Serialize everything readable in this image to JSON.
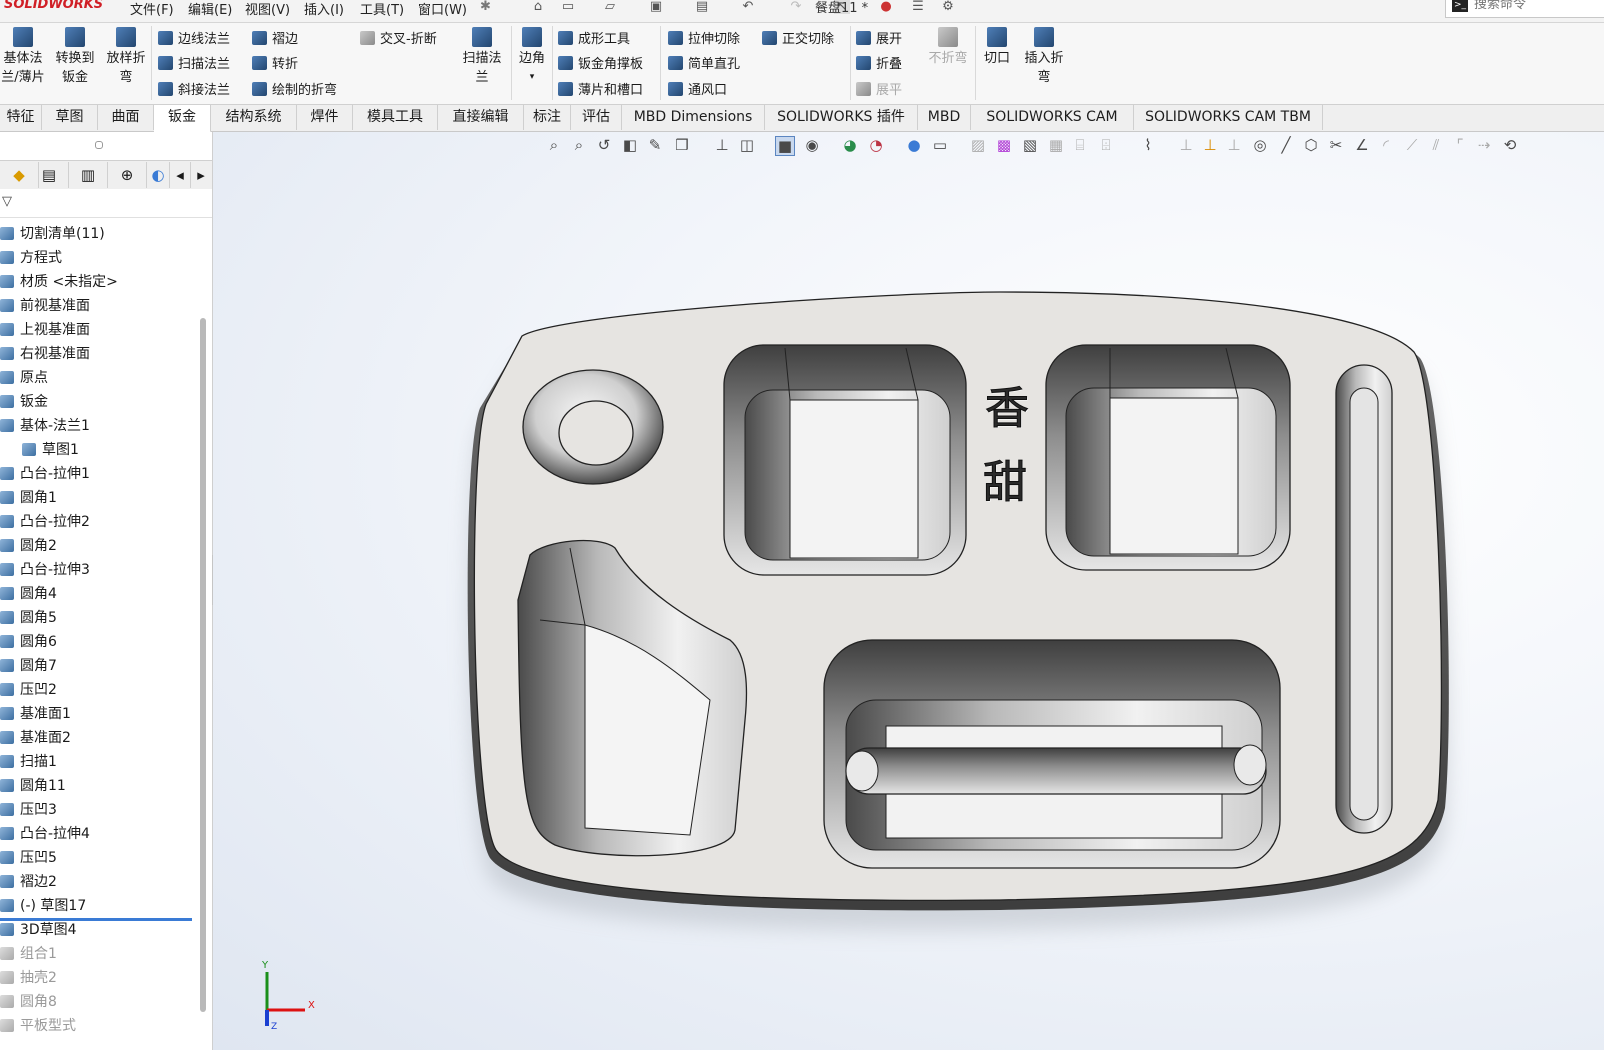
{
  "app": {
    "logo": "SOLIDWORKS",
    "document_title": "餐盘11 *"
  },
  "menu": [
    "文件(F)",
    "编辑(E)",
    "视图(V)",
    "插入(I)",
    "工具(T)",
    "窗口(W)"
  ],
  "search": {
    "placeholder": "搜索命令"
  },
  "ribbon": {
    "big_buttons": [
      {
        "label1": "基体法",
        "label2": "兰/薄片"
      },
      {
        "label1": "转换到",
        "label2": "钣金"
      },
      {
        "label1": "放样折",
        "label2": "弯"
      }
    ],
    "group1": [
      "边线法兰",
      "扫描法兰",
      "斜接法兰"
    ],
    "group2": [
      "褶边",
      "转折",
      "绘制的折弯"
    ],
    "cross_break": "交叉-折断",
    "sweep_flange": {
      "label1": "扫描法",
      "label2": "兰"
    },
    "corner": {
      "label": "边角"
    },
    "group3": [
      "成形工具",
      "钣金角撑板",
      "薄片和槽口"
    ],
    "group4": [
      "拉伸切除",
      "简单直孔",
      "通风口"
    ],
    "normal_cut": "正交切除",
    "group5": [
      "展开",
      "折叠",
      "展平"
    ],
    "no_bends": "不折弯",
    "rip": "切口",
    "insert_bends": {
      "label1": "插入折",
      "label2": "弯"
    }
  },
  "tabs": [
    "特征",
    "草图",
    "曲面",
    "钣金",
    "结构系统",
    "焊件",
    "模具工具",
    "直接编辑",
    "标注",
    "评估",
    "MBD Dimensions",
    "SOLIDWORKS 插件",
    "MBD",
    "SOLIDWORKS CAM",
    "SOLIDWORKS CAM TBM"
  ],
  "active_tab": "钣金",
  "feature_tree": [
    {
      "label": "切割清单(11)",
      "state": "active"
    },
    {
      "label": "方程式",
      "state": "active"
    },
    {
      "label": "材质 <未指定>",
      "state": "active"
    },
    {
      "label": "前视基准面",
      "state": "active"
    },
    {
      "label": "上视基准面",
      "state": "active"
    },
    {
      "label": "右视基准面",
      "state": "active"
    },
    {
      "label": "原点",
      "state": "active"
    },
    {
      "label": "钣金",
      "state": "active"
    },
    {
      "label": "基体-法兰1",
      "state": "active"
    },
    {
      "label": "草图1",
      "state": "active"
    },
    {
      "label": "凸台-拉伸1",
      "state": "active"
    },
    {
      "label": "圆角1",
      "state": "active"
    },
    {
      "label": "凸台-拉伸2",
      "state": "active"
    },
    {
      "label": "圆角2",
      "state": "active"
    },
    {
      "label": "凸台-拉伸3",
      "state": "active"
    },
    {
      "label": "圆角4",
      "state": "active"
    },
    {
      "label": "圆角5",
      "state": "active"
    },
    {
      "label": "圆角6",
      "state": "active"
    },
    {
      "label": "圆角7",
      "state": "active"
    },
    {
      "label": "压凹2",
      "state": "active"
    },
    {
      "label": "基准面1",
      "state": "active"
    },
    {
      "label": "基准面2",
      "state": "active"
    },
    {
      "label": "扫描1",
      "state": "active"
    },
    {
      "label": "圆角11",
      "state": "active"
    },
    {
      "label": "压凹3",
      "state": "active"
    },
    {
      "label": "凸台-拉伸4",
      "state": "active"
    },
    {
      "label": "压凹5",
      "state": "active"
    },
    {
      "label": "褶边2",
      "state": "active"
    },
    {
      "label": "(-) 草图17",
      "state": "active"
    },
    {
      "label": "3D草图4",
      "state": "active"
    },
    {
      "label": "组合1",
      "state": "suppressed"
    },
    {
      "label": "抽壳2",
      "state": "suppressed"
    },
    {
      "label": "圆角8",
      "state": "suppressed"
    },
    {
      "label": "平板型式",
      "state": "suppressed"
    }
  ],
  "model": {
    "embossed_text_1": "香",
    "embossed_text_2": "甜"
  },
  "triad": {
    "x_label": "X",
    "y_label": "Y",
    "z_label": "Z"
  },
  "colors": {
    "accent_blue": "#3a7bd5",
    "logo_red": "#d01f26",
    "model_face": "#e6e4e1"
  }
}
